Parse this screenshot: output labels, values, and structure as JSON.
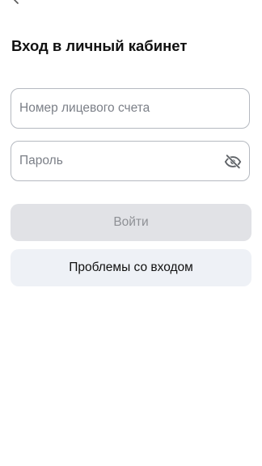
{
  "header": {
    "title": "Вход в личный кабинет",
    "back_icon": "chevron-left-icon"
  },
  "form": {
    "account_placeholder": "Номер лицевого счета",
    "account_value": "",
    "password_placeholder": "Пароль",
    "password_value": "",
    "password_toggle_icon": "eye-off-icon"
  },
  "actions": {
    "login_label": "Войти",
    "login_enabled": false,
    "problems_label": "Проблемы со входом"
  },
  "colors": {
    "input_border": "#b5b9c0",
    "login_bg_disabled": "#e1e2e6",
    "login_text_disabled": "#8e9095",
    "problems_bg": "#eef1f6"
  }
}
